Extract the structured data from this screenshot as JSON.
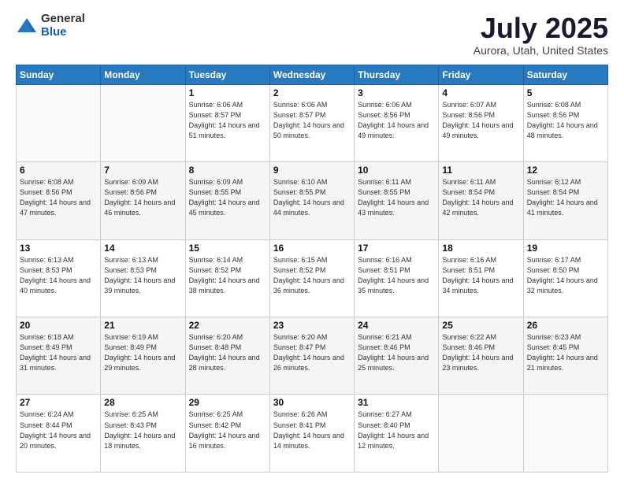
{
  "logo": {
    "general": "General",
    "blue": "Blue"
  },
  "title": "July 2025",
  "subtitle": "Aurora, Utah, United States",
  "calendar": {
    "headers": [
      "Sunday",
      "Monday",
      "Tuesday",
      "Wednesday",
      "Thursday",
      "Friday",
      "Saturday"
    ],
    "weeks": [
      [
        {
          "day": "",
          "info": ""
        },
        {
          "day": "",
          "info": ""
        },
        {
          "day": "1",
          "info": "Sunrise: 6:06 AM\nSunset: 8:57 PM\nDaylight: 14 hours and 51 minutes."
        },
        {
          "day": "2",
          "info": "Sunrise: 6:06 AM\nSunset: 8:57 PM\nDaylight: 14 hours and 50 minutes."
        },
        {
          "day": "3",
          "info": "Sunrise: 6:06 AM\nSunset: 8:56 PM\nDaylight: 14 hours and 49 minutes."
        },
        {
          "day": "4",
          "info": "Sunrise: 6:07 AM\nSunset: 8:56 PM\nDaylight: 14 hours and 49 minutes."
        },
        {
          "day": "5",
          "info": "Sunrise: 6:08 AM\nSunset: 8:56 PM\nDaylight: 14 hours and 48 minutes."
        }
      ],
      [
        {
          "day": "6",
          "info": "Sunrise: 6:08 AM\nSunset: 8:56 PM\nDaylight: 14 hours and 47 minutes."
        },
        {
          "day": "7",
          "info": "Sunrise: 6:09 AM\nSunset: 8:56 PM\nDaylight: 14 hours and 46 minutes."
        },
        {
          "day": "8",
          "info": "Sunrise: 6:09 AM\nSunset: 8:55 PM\nDaylight: 14 hours and 45 minutes."
        },
        {
          "day": "9",
          "info": "Sunrise: 6:10 AM\nSunset: 8:55 PM\nDaylight: 14 hours and 44 minutes."
        },
        {
          "day": "10",
          "info": "Sunrise: 6:11 AM\nSunset: 8:55 PM\nDaylight: 14 hours and 43 minutes."
        },
        {
          "day": "11",
          "info": "Sunrise: 6:11 AM\nSunset: 8:54 PM\nDaylight: 14 hours and 42 minutes."
        },
        {
          "day": "12",
          "info": "Sunrise: 6:12 AM\nSunset: 8:54 PM\nDaylight: 14 hours and 41 minutes."
        }
      ],
      [
        {
          "day": "13",
          "info": "Sunrise: 6:13 AM\nSunset: 8:53 PM\nDaylight: 14 hours and 40 minutes."
        },
        {
          "day": "14",
          "info": "Sunrise: 6:13 AM\nSunset: 8:53 PM\nDaylight: 14 hours and 39 minutes."
        },
        {
          "day": "15",
          "info": "Sunrise: 6:14 AM\nSunset: 8:52 PM\nDaylight: 14 hours and 38 minutes."
        },
        {
          "day": "16",
          "info": "Sunrise: 6:15 AM\nSunset: 8:52 PM\nDaylight: 14 hours and 36 minutes."
        },
        {
          "day": "17",
          "info": "Sunrise: 6:16 AM\nSunset: 8:51 PM\nDaylight: 14 hours and 35 minutes."
        },
        {
          "day": "18",
          "info": "Sunrise: 6:16 AM\nSunset: 8:51 PM\nDaylight: 14 hours and 34 minutes."
        },
        {
          "day": "19",
          "info": "Sunrise: 6:17 AM\nSunset: 8:50 PM\nDaylight: 14 hours and 32 minutes."
        }
      ],
      [
        {
          "day": "20",
          "info": "Sunrise: 6:18 AM\nSunset: 8:49 PM\nDaylight: 14 hours and 31 minutes."
        },
        {
          "day": "21",
          "info": "Sunrise: 6:19 AM\nSunset: 8:49 PM\nDaylight: 14 hours and 29 minutes."
        },
        {
          "day": "22",
          "info": "Sunrise: 6:20 AM\nSunset: 8:48 PM\nDaylight: 14 hours and 28 minutes."
        },
        {
          "day": "23",
          "info": "Sunrise: 6:20 AM\nSunset: 8:47 PM\nDaylight: 14 hours and 26 minutes."
        },
        {
          "day": "24",
          "info": "Sunrise: 6:21 AM\nSunset: 8:46 PM\nDaylight: 14 hours and 25 minutes."
        },
        {
          "day": "25",
          "info": "Sunrise: 6:22 AM\nSunset: 8:46 PM\nDaylight: 14 hours and 23 minutes."
        },
        {
          "day": "26",
          "info": "Sunrise: 6:23 AM\nSunset: 8:45 PM\nDaylight: 14 hours and 21 minutes."
        }
      ],
      [
        {
          "day": "27",
          "info": "Sunrise: 6:24 AM\nSunset: 8:44 PM\nDaylight: 14 hours and 20 minutes."
        },
        {
          "day": "28",
          "info": "Sunrise: 6:25 AM\nSunset: 8:43 PM\nDaylight: 14 hours and 18 minutes."
        },
        {
          "day": "29",
          "info": "Sunrise: 6:25 AM\nSunset: 8:42 PM\nDaylight: 14 hours and 16 minutes."
        },
        {
          "day": "30",
          "info": "Sunrise: 6:26 AM\nSunset: 8:41 PM\nDaylight: 14 hours and 14 minutes."
        },
        {
          "day": "31",
          "info": "Sunrise: 6:27 AM\nSunset: 8:40 PM\nDaylight: 14 hours and 12 minutes."
        },
        {
          "day": "",
          "info": ""
        },
        {
          "day": "",
          "info": ""
        }
      ]
    ]
  }
}
